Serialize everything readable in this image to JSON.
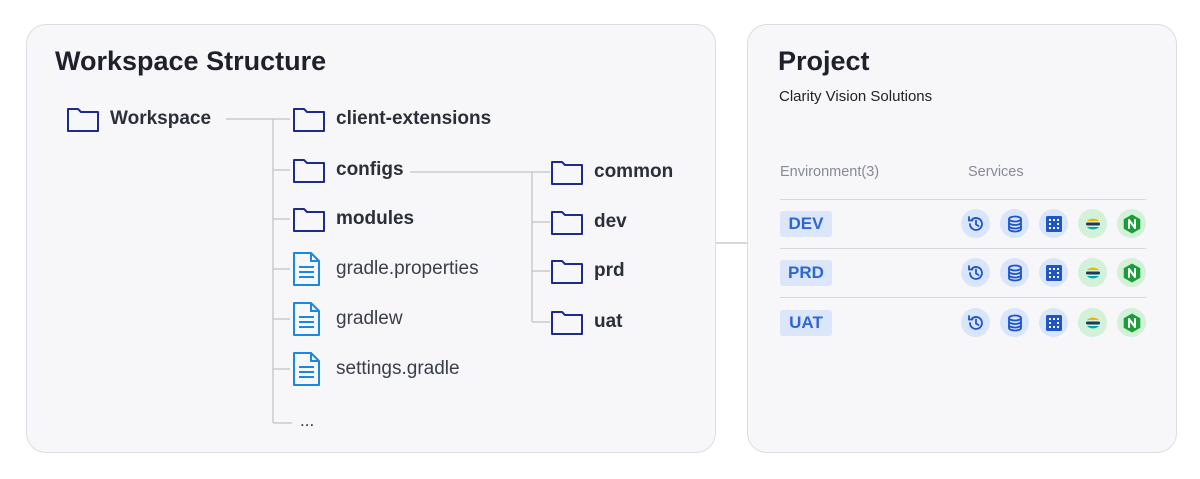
{
  "workspace": {
    "title": "Workspace Structure",
    "root": "Workspace",
    "children": [
      {
        "label": "client-extensions",
        "kind": "folder"
      },
      {
        "label": "configs",
        "kind": "folder"
      },
      {
        "label": "modules",
        "kind": "folder"
      },
      {
        "label": "gradle.properties",
        "kind": "file"
      },
      {
        "label": "gradlew",
        "kind": "file"
      },
      {
        "label": "settings.gradle",
        "kind": "file"
      },
      {
        "label": "...",
        "kind": "more"
      }
    ],
    "configs_children": [
      "common",
      "dev",
      "prd",
      "uat"
    ]
  },
  "project": {
    "title": "Project",
    "name": "Clarity Vision Solutions",
    "col_environment": "Environment(3)",
    "col_services": "Services",
    "environments": [
      {
        "name": "DEV"
      },
      {
        "name": "PRD"
      },
      {
        "name": "UAT"
      }
    ],
    "service_icons": [
      "history-icon",
      "database-icon",
      "grid-chip-icon",
      "elastic-icon",
      "nginx-icon"
    ]
  },
  "colors": {
    "folder": "#1e2a8c",
    "file": "#1a88e0",
    "badge_bg": "#dbe6fb",
    "badge_text": "#2f66d0",
    "nginx": "#1a9e3a",
    "line": "#bfc1c8"
  }
}
